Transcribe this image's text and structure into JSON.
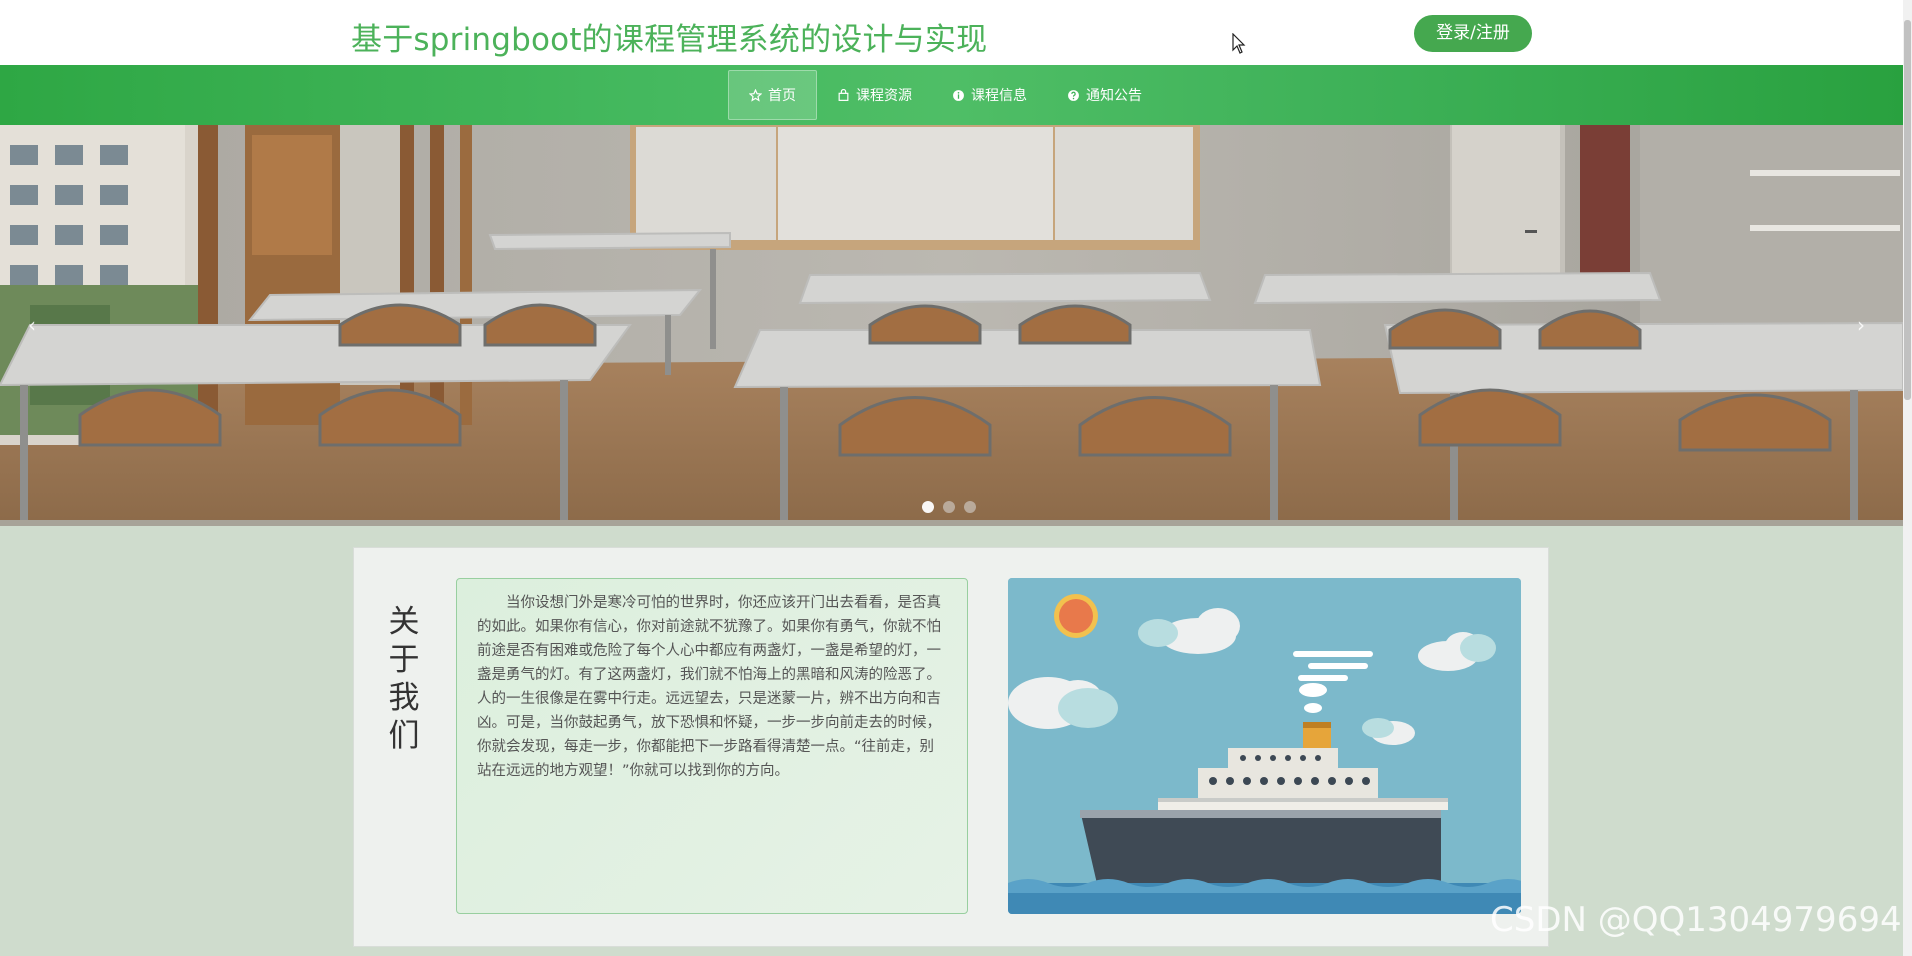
{
  "header": {
    "title": "基于springboot的课程管理系统的设计与实现",
    "login_label": "登录/注册"
  },
  "nav": {
    "items": [
      {
        "label": "首页",
        "icon": "star-icon",
        "active": true
      },
      {
        "label": "课程资源",
        "icon": "bag-icon",
        "active": false
      },
      {
        "label": "课程信息",
        "icon": "info-circle-icon",
        "active": false
      },
      {
        "label": "通知公告",
        "icon": "question-circle-icon",
        "active": false
      }
    ]
  },
  "banner": {
    "prev": "‹",
    "next": "›",
    "slides": 3,
    "active_slide": 1
  },
  "about": {
    "title": "关于我们",
    "title_chars": [
      "关",
      "于",
      "我",
      "们"
    ],
    "text": "当你设想门外是寒冷可怕的世界时，你还应该开门出去看看，是否真的如此。如果你有信心，你对前途就不犹豫了。如果你有勇气，你就不怕前途是否有困难或危险了每个人心中都应有两盏灯，一盏是希望的灯，一盏是勇气的灯。有了这两盏灯，我们就不怕海上的黑暗和风涛的险恶了。人的一生很像是在雾中行走。远远望去，只是迷蒙一片，辨不出方向和吉凶。可是，当你鼓起勇气，放下恐惧和怀疑，一步一步向前走去的时候，你就会发现，每走一步，你都能把下一步路看得清楚一点。“往前走，别站在远远的地方观望！”你就可以找到你的方向。"
  },
  "watermark": "CSDN @QQ1304979694",
  "colors": {
    "brand_green": "#4cb25a",
    "nav_green": "#3fb259",
    "button_green": "#45a84f"
  }
}
